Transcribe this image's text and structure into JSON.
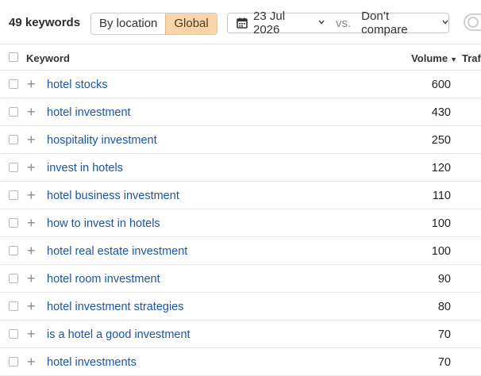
{
  "toolbar": {
    "keyword_count": "49 keywords",
    "scope_options": [
      "By location",
      "Global"
    ],
    "scope_selected": "Global",
    "date": "23 Jul 2026",
    "vs_label": "vs.",
    "compare": "Don’t compare"
  },
  "table": {
    "headers": {
      "keyword": "Keyword",
      "volume": "Volume",
      "traffic": "Traffic"
    },
    "sort_column": "Volume",
    "sort_direction": "desc",
    "rows": [
      {
        "keyword": "hotel stocks",
        "volume": "600"
      },
      {
        "keyword": "hotel investment",
        "volume": "430"
      },
      {
        "keyword": "hospitality investment",
        "volume": "250"
      },
      {
        "keyword": "invest in hotels",
        "volume": "120"
      },
      {
        "keyword": "hotel business investment",
        "volume": "110"
      },
      {
        "keyword": "how to invest in hotels",
        "volume": "100"
      },
      {
        "keyword": "hotel real estate investment",
        "volume": "100"
      },
      {
        "keyword": "hotel room investment",
        "volume": "90"
      },
      {
        "keyword": "hotel investment strategies",
        "volume": "80"
      },
      {
        "keyword": "is a hotel a good investment",
        "volume": "70"
      },
      {
        "keyword": "hotel investments",
        "volume": "70"
      }
    ]
  },
  "colors": {
    "link": "#1a56a6",
    "active_segment": "#fbd5a8"
  }
}
